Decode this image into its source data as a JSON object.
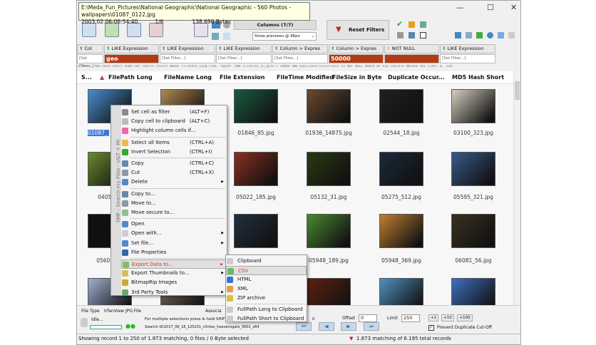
{
  "tooltip": {
    "path": "E:\\Meda_Fun_Pictures\\National Geographic\\National Geographic - 560 Photos - wallpapers\\01087_0122.jpg",
    "date": "2003.02.06-06:54:40",
    "index": "1/6",
    "size": "138.690 Bytes"
  },
  "window": {
    "minimize": "—",
    "maximize": "☐",
    "close": "✕"
  },
  "toolbar": {
    "columns_label": "Columns (7/7)",
    "preview_select": "Show previews @ 96px",
    "reset_filters": "Reset Filters"
  },
  "filters": [
    {
      "op": "Col",
      "value": "[Set Filter...]",
      "active": false
    },
    {
      "op": "LIKE Expression",
      "value": "geo",
      "active": true
    },
    {
      "op": "LIKE Expression",
      "value": "[Set Filter...]",
      "active": false
    },
    {
      "op": "LIKE Expression",
      "value": "[Set Filter...]",
      "active": false
    },
    {
      "op": "Column > Expres",
      "value": "[Set Filter...]",
      "active": false
    },
    {
      "op": "Column > Expres",
      "value": "50000",
      "active": true
    },
    {
      "op": "NOT NULL",
      "value": "",
      "active": true
    },
    {
      "op": "LIKE Expression",
      "value": "[Set Filter...]",
      "active": false
    }
  ],
  "sql": "urrence, MD5_Hash_Short FROM smf_search_result WHERE FilePath_Long LIKE '%geo%' AND FileSize_in_Byte > 50000 AND Duplicate_Occurrence IS NOT NULL ORDER BY SID COLLATE NOCASE ASC LIMIT 0, 250;",
  "columns": [
    "S...",
    "FilePath Long",
    "FileName Long",
    "File Extension",
    "FileTime Modified",
    "FileSize in Byte",
    "Duplicate Occur...",
    "MD5 Hash Short"
  ],
  "thumbnails": [
    [
      "01087_",
      "",
      "01846_85.jpg",
      "01936_14875.jpg",
      "02544_18.jpg",
      "03100_323.jpg"
    ],
    [
      "04055",
      "",
      "05022_185.jpg",
      "05132_31.jpg",
      "05275_512.jpg",
      "05595_321.jpg"
    ],
    [
      "05605_",
      "",
      "",
      "05948_189.jpg",
      "05948_369.jpg",
      "06081_56.jpg"
    ],
    [
      "",
      "",
      "",
      "",
      "",
      ""
    ]
  ],
  "thumb_colors": [
    [
      "#4a8ed0",
      "#b08850",
      "#1a5a40",
      "#6a4a30",
      "#202020",
      "#d8d0c0"
    ],
    [
      "#6a8a30",
      "#303020",
      "#8a3020",
      "#2a3a10",
      "#1a2a3a",
      "#3a5a8a"
    ],
    [
      "#101010",
      "#303030",
      "#203040",
      "#4a8a30",
      "#c08030",
      "#3a3020"
    ],
    [
      "#a0b0d0",
      "#807060",
      "#202020",
      "#602010",
      "#5090c0",
      "#4070c0"
    ]
  ],
  "context_menu": {
    "side_label": "SMF - Search my Files - (ALT + M)",
    "items": [
      {
        "label": "Set cell as filter",
        "shortcut": "(ALT+F)",
        "icon": "filter-icon",
        "color": "#889"
      },
      {
        "label": "Copy cell to clipboard",
        "shortcut": "(ALT+C)",
        "icon": "clipboard-icon",
        "color": "#bbb"
      },
      {
        "label": "Highlight column cells if...",
        "shortcut": "",
        "icon": "color-wheel-icon",
        "color": "#e6a"
      },
      {
        "label": "Select all Items",
        "shortcut": "(CTRL+A)",
        "icon": "folder-icon",
        "color": "#eb4"
      },
      {
        "label": "Invert Selection",
        "shortcut": "(CTRL+I)",
        "icon": "invert-arrow-icon",
        "color": "#3a3"
      },
      {
        "label": "Copy",
        "shortcut": "(CTRL+C)",
        "icon": "copy-icon",
        "color": "#68a"
      },
      {
        "label": "Cut",
        "shortcut": "(CTRL+X)",
        "icon": "cut-icon",
        "color": "#89a"
      },
      {
        "label": "Delete",
        "shortcut": "",
        "icon": "delete-icon",
        "color": "#58c",
        "submenu": true
      },
      {
        "label": "Copy to...",
        "shortcut": "",
        "icon": "copy-to-icon",
        "color": "#68a"
      },
      {
        "label": "Move to...",
        "shortcut": "",
        "icon": "move-to-icon",
        "color": "#89a"
      },
      {
        "label": "Move secure to...",
        "shortcut": "",
        "icon": "move-secure-icon",
        "color": "#9b9"
      },
      {
        "label": "Open",
        "shortcut": "",
        "icon": "open-icon",
        "color": "#58c"
      },
      {
        "label": "Open with...",
        "shortcut": "",
        "icon": "open-with-icon",
        "color": "#ccd",
        "submenu": true
      },
      {
        "label": "Set file...",
        "shortcut": "",
        "icon": "set-file-icon",
        "color": "#58c",
        "submenu": true
      },
      {
        "label": "File Properties",
        "shortcut": "",
        "icon": "info-icon",
        "color": "#36a"
      },
      {
        "label": "Export Data to...",
        "shortcut": "",
        "icon": "export-icon",
        "color": "#8b6",
        "submenu": true,
        "highlight": true
      },
      {
        "label": "Export Thumbnails to...",
        "shortcut": "",
        "icon": "export-thumbnails-icon",
        "color": "#db5",
        "submenu": true
      },
      {
        "label": "BitmapRip Images",
        "shortcut": "",
        "icon": "bitmap-icon",
        "color": "#ca3"
      },
      {
        "label": "3rd Party Tools",
        "shortcut": "",
        "icon": "tools-icon",
        "color": "#6a6",
        "submenu": true
      }
    ]
  },
  "submenu": {
    "items": [
      {
        "label": "Clipboard",
        "icon": "clipboard-icon",
        "color": "#ccc"
      },
      {
        "label": "CSV",
        "icon": "csv-icon",
        "color": "#6b6",
        "highlight": true
      },
      {
        "label": "HTML",
        "icon": "html-icon",
        "color": "#37c"
      },
      {
        "label": "XML",
        "icon": "xml-icon",
        "color": "#e94"
      },
      {
        "label": "ZIP archive",
        "icon": "zip-icon",
        "color": "#db4"
      },
      {
        "label": "FullPath Long to Clipboard",
        "icon": "clipboard-icon",
        "color": "#ccc"
      },
      {
        "label": "FullPath Short to Clipboard",
        "icon": "clipboard-icon",
        "color": "#ccc"
      }
    ]
  },
  "bottom": {
    "file_type_label": "File Type",
    "file_type": "IrfanView JPG File",
    "assoc_label": "Associa",
    "idle": "Idle...",
    "hint": "For multiple selections press & hold SHIFT",
    "hint_tail": "0",
    "search_id_label": "Search ID:",
    "search_id": "2017_06_18_125231_c0ntex_heavensgate_0602_x64",
    "offset_label": "Offset",
    "offset": "0",
    "limit_label": "Limit",
    "limit": "250",
    "step1": "+1",
    "step10": "+10",
    "step100": "+100",
    "prevent_dup": "Prevent Duplicate Cut-Off",
    "prevent_dup_checked": true
  },
  "status": {
    "left": "Showing record 1 to 250 of 1.873 matching, 0 files / 0 Byte selected",
    "right": "1.873 matching of 6.195 total records"
  }
}
